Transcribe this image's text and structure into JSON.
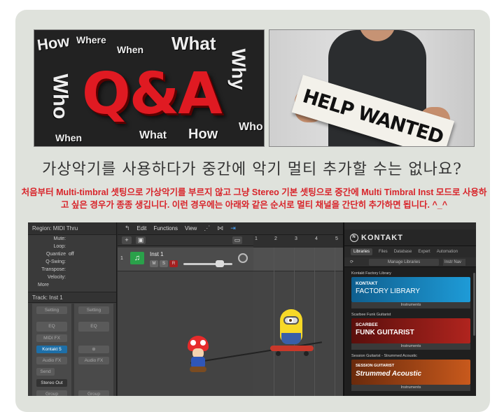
{
  "headline": "가상악기를 사용하다가 중간에 악기 멀티 추가할 수는 없나요?",
  "description": "처음부터 Multi-timbral 셋팅으로 가상악기를 부르지 않고 그냥 Stereo 기본 셋팅으로 중간에 Multi Timbral Inst 모드로 사용하고 싶은 경우가 종종 생깁니다. 이런 경우에는 아래와 같은 순서로 멀티 채널을 간단히 추가하면 됩니다. ^_^",
  "images": {
    "qa_text": "Q&A",
    "qa_words": [
      "How",
      "What",
      "When",
      "Where",
      "Who",
      "Why",
      "How",
      "What",
      "When",
      "Who"
    ],
    "help_sign": "HELP WANTED"
  },
  "inspector": {
    "region_title": "Region: MIDI Thru",
    "rows": [
      {
        "label": "Mute:",
        "value": ""
      },
      {
        "label": "Loop:",
        "value": ""
      },
      {
        "label": "Quantize",
        "value": "off"
      },
      {
        "label": "Q-Swing:",
        "value": ""
      },
      {
        "label": "Transpose:",
        "value": ""
      },
      {
        "label": "Velocity:",
        "value": ""
      }
    ],
    "more": "More",
    "track_title": "Track:  Inst 1",
    "strip_left": [
      "Setting",
      "EQ",
      "MIDI FX",
      "Kontakt 5",
      "Audio FX",
      "Send",
      "Stereo Out",
      "Group"
    ],
    "strip_right": [
      "Setting",
      "EQ",
      "",
      "Audio FX",
      "Group"
    ]
  },
  "toolbar": {
    "edit": "Edit",
    "functions": "Functions",
    "view": "View"
  },
  "track": {
    "number": "1",
    "name": "Inst 1",
    "mute": "M",
    "solo": "S",
    "rec": "R"
  },
  "ruler": [
    "1",
    "2",
    "3",
    "4",
    "5"
  ],
  "kontakt": {
    "logo": "KONTAKT",
    "tabs": [
      "Libraries",
      "Files",
      "Database",
      "Expert",
      "Automation"
    ],
    "manage": "Manage Libraries",
    "search": "Instr Nav",
    "libraries": [
      {
        "section": "Kontakt Factory Library",
        "title1": "KONTAKT",
        "title2": "FACTORY LIBRARY",
        "footer": "Instruments",
        "color": "#1e9bd7"
      },
      {
        "section": "Scarbee Funk Guitarist",
        "title1": "SCARBEE",
        "title2": "FUNK GUITARIST",
        "footer": "Instruments",
        "color": "#b0241e"
      },
      {
        "section": "Session Guitarist - Strummed Acoustic",
        "title1": "SESSION GUITARIST",
        "title2": "Strummed Acoustic",
        "footer": "Instruments",
        "color": "#c8591c"
      }
    ]
  }
}
